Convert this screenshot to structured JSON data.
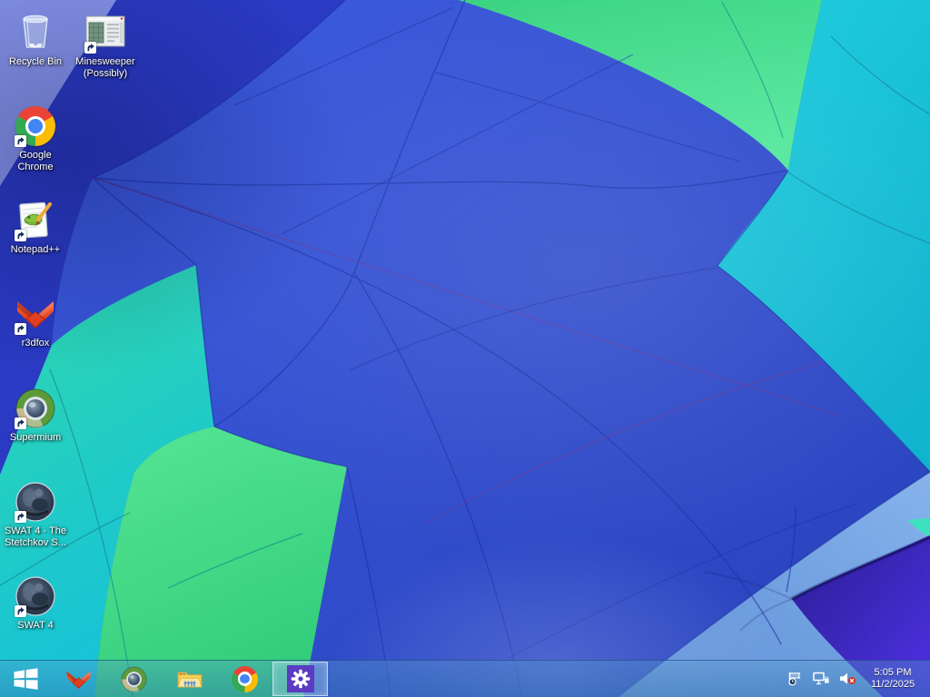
{
  "wallpaper": {
    "description": "Close-up photo of a multicolored hot air balloon canopy",
    "palette": {
      "base_blue": "#3350d2",
      "dark_blue": "#2a3ac2",
      "periwinkle": "#8593e9",
      "teal": "#1fd0c4",
      "green_bottom": "#41db87",
      "green_top": "#3fd98c",
      "cyan": "#17c4d8",
      "light_blue": "#74a4e4",
      "purple": "#4a2ede"
    }
  },
  "desktop": {
    "icons": [
      {
        "id": "recycle-bin",
        "label": "Recycle Bin",
        "shortcut": false
      },
      {
        "id": "minesweeper",
        "label": "Minesweeper (Possibly)",
        "shortcut": true
      },
      {
        "id": "google-chrome",
        "label": "Google Chrome",
        "shortcut": true
      },
      {
        "id": "notepad-plus-plus",
        "label": "Notepad++",
        "shortcut": true
      },
      {
        "id": "r3dfox",
        "label": "r3dfox",
        "shortcut": true
      },
      {
        "id": "supermium",
        "label": "Supermium",
        "shortcut": true
      },
      {
        "id": "swat4-stetchkov",
        "label": "SWAT 4 - The Stetchkov S...",
        "shortcut": true
      },
      {
        "id": "swat4",
        "label": "SWAT 4",
        "shortcut": true
      }
    ]
  },
  "taskbar": {
    "start": {
      "icon": "windows-logo"
    },
    "pinned": [
      {
        "icon": "r3dfox-icon",
        "active": false
      },
      {
        "icon": "supermium-icon",
        "active": false
      },
      {
        "icon": "file-explorer-icon",
        "active": false
      },
      {
        "icon": "chrome-icon",
        "active": false
      },
      {
        "icon": "settings-gear-icon",
        "active": true
      }
    ],
    "settings_tile_color": "#5a3bc2",
    "tray": {
      "icons": [
        "action-center-flag-icon",
        "network-icon",
        "volume-muted-icon"
      ],
      "clock": {
        "time": "5:05 PM",
        "date": "11/2/2025"
      }
    }
  }
}
